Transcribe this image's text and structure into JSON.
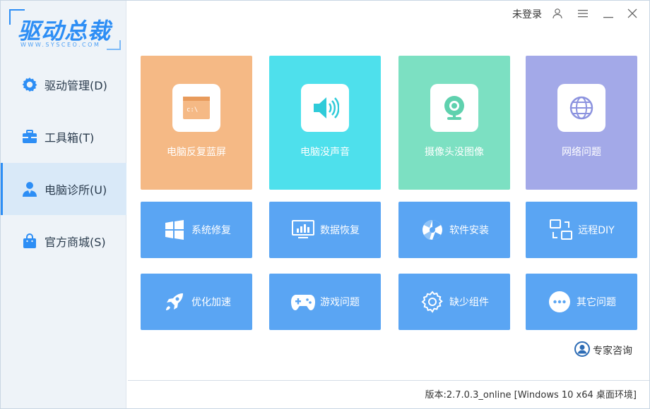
{
  "app": {
    "logo_text": "驱动总裁",
    "logo_sub": "WWW.SYSCEO.COM"
  },
  "sidebar": {
    "items": [
      {
        "label": "驱动管理(D)",
        "icon": "gear-icon",
        "active": false
      },
      {
        "label": "工具箱(T)",
        "icon": "toolbox-icon",
        "active": false
      },
      {
        "label": "电脑诊所(U)",
        "icon": "doctor-icon",
        "active": true
      },
      {
        "label": "官方商城(S)",
        "icon": "shopping-bag-icon",
        "active": false
      }
    ]
  },
  "titlebar": {
    "login": "未登录",
    "icons": [
      "user-icon",
      "menu-icon",
      "minimize-icon",
      "close-icon"
    ]
  },
  "big_tiles": [
    {
      "label": "电脑反复蓝屏",
      "icon": "terminal-window-icon",
      "color": "#f5b985"
    },
    {
      "label": "电脑没声音",
      "icon": "speaker-icon",
      "color": "#4ee0ec"
    },
    {
      "label": "摄像头没图像",
      "icon": "webcam-icon",
      "color": "#7ce0c2"
    },
    {
      "label": "网络问题",
      "icon": "globe-icon",
      "color": "#a3a9e8"
    }
  ],
  "small_tiles": [
    {
      "label": "系统修复",
      "icon": "windows-icon"
    },
    {
      "label": "数据恢复",
      "icon": "monitor-chart-icon"
    },
    {
      "label": "软件安装",
      "icon": "aperture-icon"
    },
    {
      "label": "远程DIY",
      "icon": "remote-screens-icon"
    },
    {
      "label": "优化加速",
      "icon": "rocket-icon"
    },
    {
      "label": "游戏问题",
      "icon": "gamepad-icon"
    },
    {
      "label": "缺少组件",
      "icon": "settings-cog-icon"
    },
    {
      "label": "其它问题",
      "icon": "more-dots-icon"
    }
  ],
  "expert": {
    "label": "专家咨询",
    "icon": "expert-avatar-icon"
  },
  "footer": {
    "version": "版本:2.7.0.3_online [Windows 10 x64 桌面环境]"
  },
  "colors": {
    "accent": "#2d8ef5",
    "small_tile": "#5aa5f3",
    "sidebar_bg": "#eef3f8",
    "active_bg": "#d9e9f8"
  }
}
